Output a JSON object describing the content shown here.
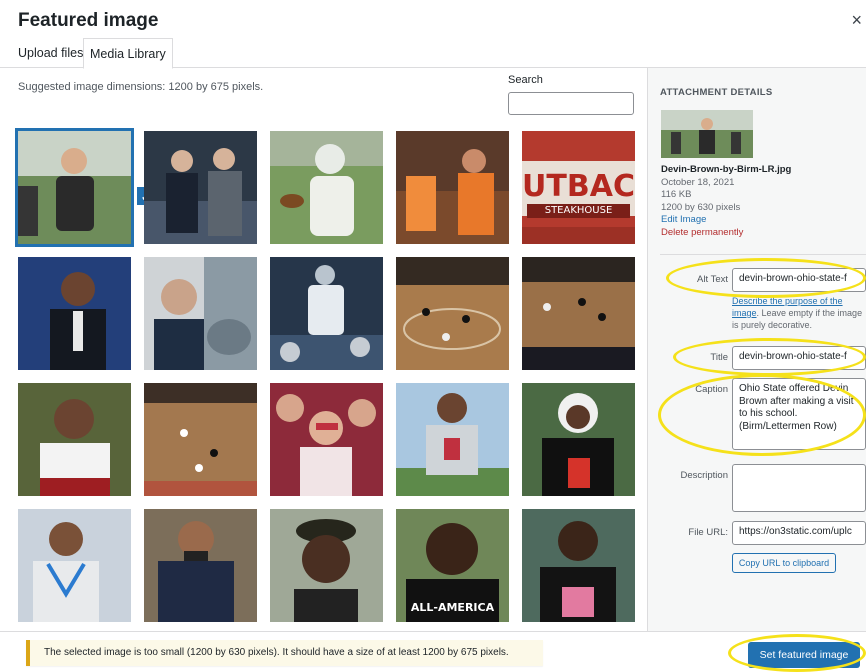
{
  "modal": {
    "title": "Featured image",
    "close_icon": "×"
  },
  "tabs": [
    {
      "label": "Upload files"
    },
    {
      "label": "Media Library"
    }
  ],
  "browser": {
    "suggested": "Suggested image dimensions: 1200 by 675 pixels.",
    "search_label": "Search",
    "search_value": "",
    "check_icon": "✓",
    "thumbnails": [
      {
        "label": ""
      },
      {
        "label": ""
      },
      {
        "label": ""
      },
      {
        "label": ""
      },
      {
        "label": "UTBAC"
      },
      {
        "label": ""
      },
      {
        "label": ""
      },
      {
        "label": ""
      },
      {
        "label": ""
      },
      {
        "label": ""
      },
      {
        "label": ""
      },
      {
        "label": ""
      },
      {
        "label": ""
      },
      {
        "label": ""
      },
      {
        "label": ""
      },
      {
        "label": ""
      },
      {
        "label": ""
      },
      {
        "label": ""
      },
      {
        "label": "ALL-AMERICA"
      },
      {
        "label": ""
      }
    ],
    "sign_text": "STEAKHOUSE"
  },
  "details": {
    "heading": "ATTACHMENT DETAILS",
    "filename": "Devin-Brown-by-Birm-LR.jpg",
    "date": "October 18, 2021",
    "size": "116 KB",
    "dimensions": "1200 by 630 pixels",
    "edit_link": "Edit Image",
    "delete_link": "Delete permanently",
    "alt_label": "Alt Text",
    "alt_value": "devin-brown-ohio-state-f",
    "alt_help_link": "Describe the purpose of the image",
    "alt_help_rest": ". Leave empty if the image is purely decorative.",
    "title_label": "Title",
    "title_value": "devin-brown-ohio-state-f",
    "caption_label": "Caption",
    "caption_value": "Ohio State offered Devin Brown after making a visit to his school. (Birm/Lettermen Row)",
    "description_label": "Description",
    "description_value": "",
    "url_label": "File URL:",
    "url_value": "https://on3static.com/uplc",
    "copy_label": "Copy URL to clipboard"
  },
  "footer": {
    "notice": "The selected image is too small (1200 by 630 pixels). It should have a size of at least 1200 by 675 pixels.",
    "set_button": "Set featured image"
  },
  "colors": {
    "accent": "#2271b1",
    "annotation": "#f5e11a",
    "notice_border": "#dba617"
  }
}
